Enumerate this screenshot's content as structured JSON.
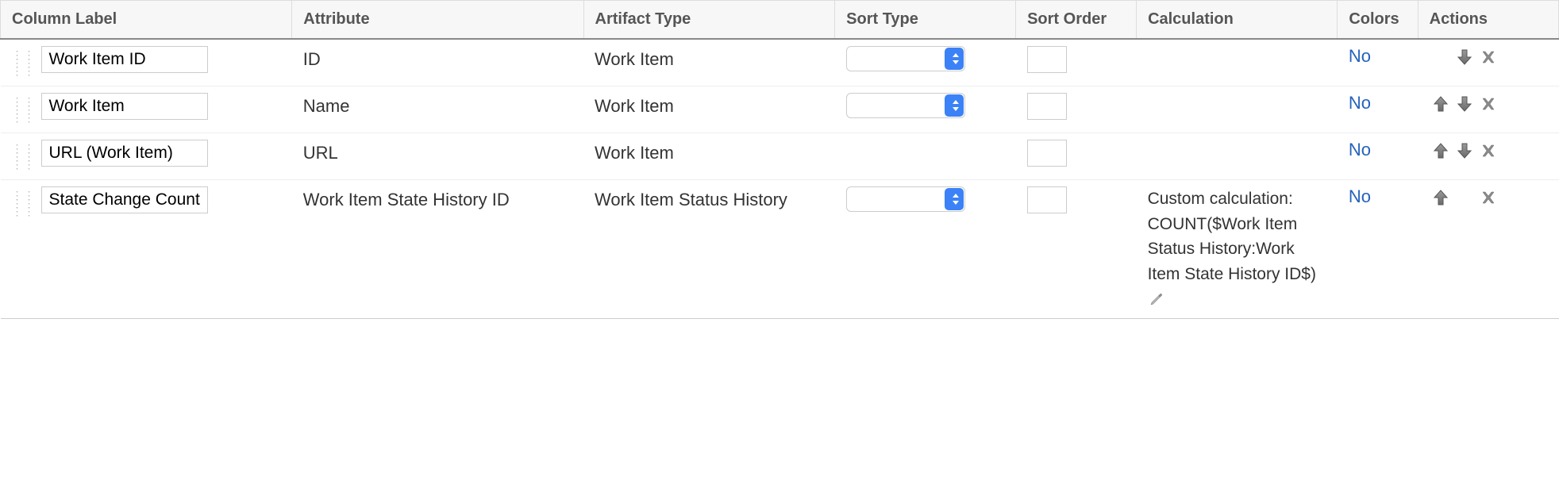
{
  "headers": {
    "column_label": "Column Label",
    "attribute": "Attribute",
    "artifact_type": "Artifact Type",
    "sort_type": "Sort Type",
    "sort_order": "Sort Order",
    "calculation": "Calculation",
    "colors": "Colors",
    "actions": "Actions"
  },
  "rows": [
    {
      "label": "Work Item ID",
      "attribute": "ID",
      "artifact_type": "Work Item",
      "sort_type_visible": true,
      "sort_type": "",
      "sort_order": "",
      "calculation": "",
      "colors": "No",
      "has_edit": false,
      "actions": {
        "up": false,
        "down": true,
        "delete": true
      }
    },
    {
      "label": "Work Item",
      "attribute": "Name",
      "artifact_type": "Work Item",
      "sort_type_visible": true,
      "sort_type": "",
      "sort_order": "",
      "calculation": "",
      "colors": "No",
      "has_edit": false,
      "actions": {
        "up": true,
        "down": true,
        "delete": true
      }
    },
    {
      "label": "URL (Work Item)",
      "attribute": "URL",
      "artifact_type": "Work Item",
      "sort_type_visible": false,
      "sort_type": "",
      "sort_order": "",
      "calculation": "",
      "colors": "No",
      "has_edit": false,
      "actions": {
        "up": true,
        "down": true,
        "delete": true
      }
    },
    {
      "label": "State Change Count",
      "attribute": "Work Item State History ID",
      "artifact_type": "Work Item Status History",
      "sort_type_visible": true,
      "sort_type": "",
      "sort_order": "",
      "calculation": "Custom calculation: COUNT($Work Item Status History:Work Item State History ID$)",
      "colors": "No",
      "has_edit": true,
      "actions": {
        "up": true,
        "down": false,
        "delete": true
      }
    }
  ]
}
